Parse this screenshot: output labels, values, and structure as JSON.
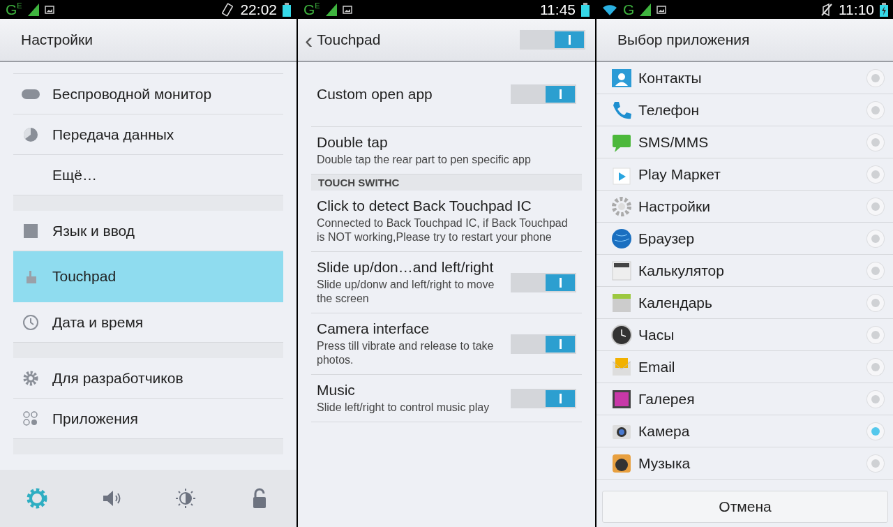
{
  "screens": [
    {
      "status": {
        "network": "G",
        "network_sub": "E",
        "time": "22:02",
        "wifi": false,
        "muted": false,
        "vibrate": true,
        "charging": false
      },
      "title": "Настройки",
      "items": [
        {
          "kind": "item",
          "label": "Беспроводной монитор",
          "selected": false
        },
        {
          "kind": "item",
          "label": "Передача данных",
          "selected": false
        },
        {
          "kind": "item",
          "label": "Ещё…",
          "selected": false
        },
        {
          "kind": "spacer"
        },
        {
          "kind": "item",
          "label": "Язык и ввод",
          "selected": false
        },
        {
          "kind": "item",
          "label": "Touchpad",
          "selected": true
        },
        {
          "kind": "item",
          "label": "Дата и время",
          "selected": false
        },
        {
          "kind": "spacer"
        },
        {
          "kind": "item",
          "label": "Для разработчиков",
          "selected": false
        },
        {
          "kind": "item",
          "label": "Приложения",
          "selected": false
        },
        {
          "kind": "spacer"
        }
      ],
      "bottom_bar": [
        {
          "selected": true
        },
        {
          "selected": false
        },
        {
          "selected": false
        },
        {
          "selected": false
        }
      ]
    },
    {
      "status": {
        "network": "G",
        "network_sub": "E",
        "time": "11:45",
        "wifi": false,
        "muted": false,
        "vibrate": false,
        "charging": false
      },
      "title": "Touchpad",
      "back": "‹",
      "master_on": true,
      "items": [
        {
          "kind": "toggle",
          "title": "Custom open app",
          "on": true
        },
        {
          "kind": "text",
          "title": "Double tap",
          "summary": "Double tap the rear part to pen specific app"
        },
        {
          "kind": "section",
          "title": "TOUCH SWITHC"
        },
        {
          "kind": "text",
          "title": "Click to detect Back Touchpad IC",
          "summary": "Connected to Back Touchpad IC, if Back Touchpad is NOT working,Please try to restart your phone"
        },
        {
          "kind": "toggle",
          "title": "Slide up/don…and left/right",
          "summary": "Slide up/donw and left/right to move the screen",
          "on": true
        },
        {
          "kind": "toggle",
          "title": "Camera interface",
          "summary": "Press till vibrate and release to take photos.",
          "on": true
        },
        {
          "kind": "toggle",
          "title": "Music",
          "summary": "Slide left/right to control music play",
          "on": true
        }
      ]
    },
    {
      "status": {
        "network": "G",
        "time": "11:10",
        "wifi": true,
        "muted": true,
        "vibrate": false,
        "charging": true
      },
      "title": "Выбор приложения",
      "apps": [
        {
          "label": "Контакты",
          "selected": false
        },
        {
          "label": "Телефон",
          "selected": false
        },
        {
          "label": "SMS/MMS",
          "selected": false
        },
        {
          "label": "Play Маркет",
          "selected": false
        },
        {
          "label": "Настройки",
          "selected": false
        },
        {
          "label": "Браузер",
          "selected": false
        },
        {
          "label": "Калькулятор",
          "selected": false
        },
        {
          "label": "Календарь",
          "selected": false
        },
        {
          "label": "Часы",
          "selected": false
        },
        {
          "label": "Email",
          "selected": false
        },
        {
          "label": "Галерея",
          "selected": false
        },
        {
          "label": "Камера",
          "selected": true
        },
        {
          "label": "Музыка",
          "selected": false
        }
      ],
      "cancel": "Отмена"
    }
  ]
}
